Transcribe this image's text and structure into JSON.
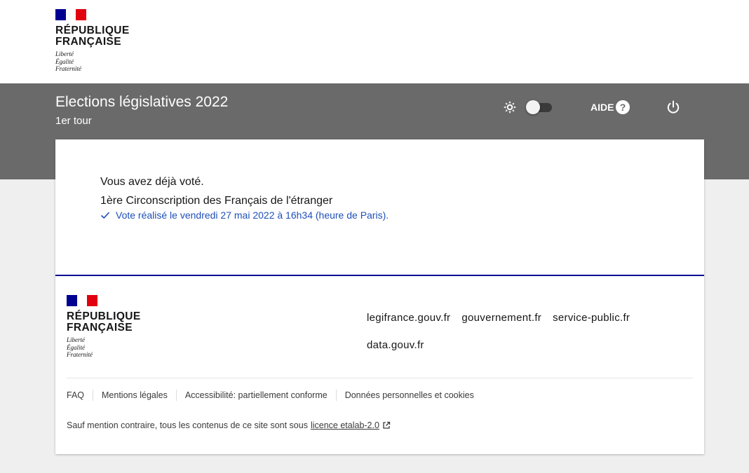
{
  "header": {
    "logo": {
      "line1": "RÉPUBLIQUE",
      "line2": "FRANÇAISE",
      "motto1": "Liberté",
      "motto2": "Égalité",
      "motto3": "Fraternité"
    },
    "title": "Elections législatives 2022",
    "subtitle": "1er tour",
    "theme_toggle": {
      "light_icon": "sun-icon",
      "dark_icon": "moon-icon",
      "state": "light"
    },
    "help_label": "AIDE",
    "help_icon": "question-circle-icon",
    "logout_icon": "power-icon"
  },
  "main": {
    "already_voted": "Vous avez déjà voté.",
    "constituency": "1ère Circonscription des Français de l'étranger",
    "vote_time": "Vote réalisé le vendredi 27 mai 2022 à 16h34 (heure de Paris)."
  },
  "footer": {
    "logo": {
      "line1": "RÉPUBLIQUE",
      "line2": "FRANÇAISE",
      "motto1": "Liberté",
      "motto2": "Égalité",
      "motto3": "Fraternité"
    },
    "links": [
      "legifrance.gouv.fr",
      "gouvernement.fr",
      "service-public.fr",
      "data.gouv.fr"
    ],
    "nav": [
      "FAQ",
      "Mentions légales",
      "Accessibilité: partiellement conforme",
      "Données personnelles et cookies"
    ],
    "license_text": "Sauf mention contraire, tous les contenus de ce site sont sous",
    "license_link": "licence etalab-2.0"
  },
  "colors": {
    "band": "#6a6a6a",
    "blue_france": "#000091",
    "red_marianne": "#e1000f",
    "link_blue": "#1f4fb8"
  }
}
